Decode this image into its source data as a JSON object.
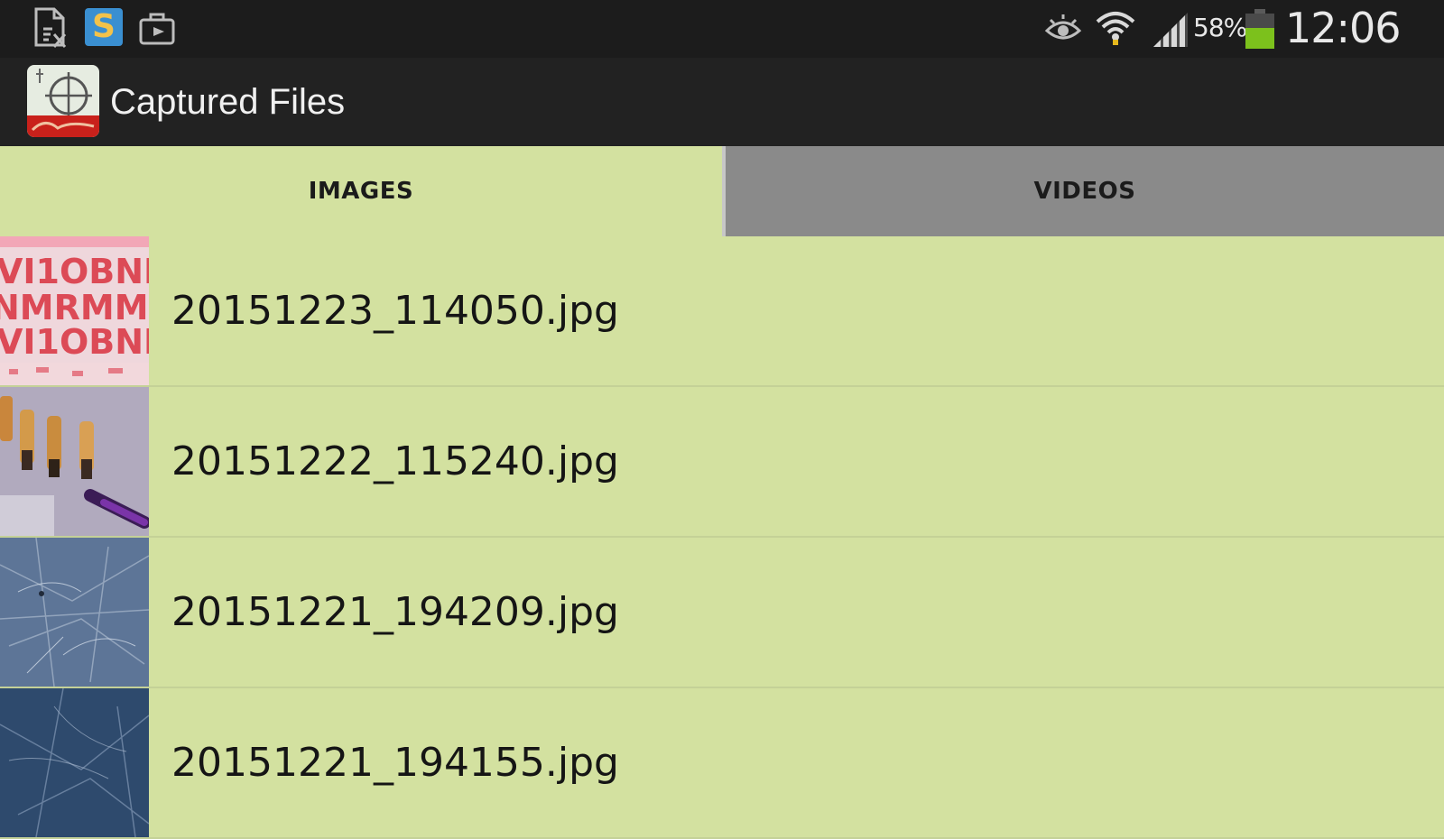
{
  "status_bar": {
    "icons": [
      "document-x-icon",
      "s-app-icon",
      "briefcase-icon",
      "eye-icon",
      "wifi-icon",
      "signal-icon",
      "battery-icon"
    ],
    "battery_percent": "58%",
    "battery_level": 0.58,
    "time": "12:06"
  },
  "action_bar": {
    "title": "Captured Files",
    "app_icon": "microscope-crosshair-icon"
  },
  "tabs": [
    {
      "label": "IMAGES",
      "selected": true
    },
    {
      "label": "VIDEOS",
      "selected": false
    }
  ],
  "files": [
    {
      "name": "20151223_114050.jpg",
      "thumbnail": "pink-text-macro"
    },
    {
      "name": "20151222_115240.jpg",
      "thumbnail": "circuit-components"
    },
    {
      "name": "20151221_194209.jpg",
      "thumbnail": "blue-scratched-surface"
    },
    {
      "name": "20151221_194155.jpg",
      "thumbnail": "dark-blue-scratched-surface"
    }
  ],
  "colors": {
    "status_bar_bg": "#1c1c1c",
    "action_bar_bg": "#222222",
    "list_bg": "#d3e1a0",
    "tab_inactive_bg": "#8a8a8a",
    "battery_green": "#7cc11c"
  }
}
